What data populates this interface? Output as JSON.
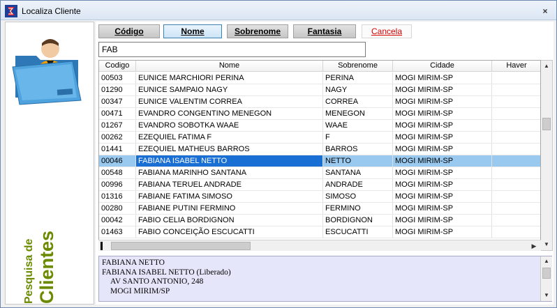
{
  "window": {
    "title": "Localiza Cliente",
    "close_glyph": "×"
  },
  "side_panel": {
    "line1": "Pesquisa de",
    "line2": "Clientes",
    "accent_color": "#6b8a00"
  },
  "buttons": {
    "codigo": "Código",
    "nome": "Nome",
    "sobrenome": "Sobrenome",
    "fantasia": "Fantasia",
    "cancela": "Cancela"
  },
  "search": {
    "value": "FAB"
  },
  "grid": {
    "columns": [
      "Codigo",
      "Nome",
      "Sobrenome",
      "Cidade",
      "Haver"
    ],
    "rows": [
      [
        "00503",
        "EUNICE MARCHIORI PERINA",
        "PERINA",
        "MOGI MIRIM-SP",
        ""
      ],
      [
        "01290",
        "EUNICE SAMPAIO NAGY",
        "NAGY",
        "MOGI MIRIM-SP",
        ""
      ],
      [
        "00347",
        "EUNICE VALENTIM CORREA",
        "CORREA",
        "MOGI MIRIM-SP",
        ""
      ],
      [
        "00471",
        "EVANDRO CONGENTINO MENEGON",
        "MENEGON",
        "MOGI MIRIM-SP",
        ""
      ],
      [
        "01267",
        "EVANDRO SOBOTKA WAAE",
        "WAAE",
        "MOGI MIRIM-SP",
        ""
      ],
      [
        "00262",
        "EZEQUIEL FATIMA F",
        "F",
        "MOGI MIRIM-SP",
        ""
      ],
      [
        "01441",
        "EZEQUIEL MATHEUS BARROS",
        "BARROS",
        "MOGI MIRIM-SP",
        ""
      ],
      [
        "00046",
        "FABIANA ISABEL NETTO",
        "NETTO",
        "MOGI MIRIM-SP",
        ""
      ],
      [
        "00548",
        "FABIANA MARINHO SANTANA",
        "SANTANA",
        "MOGI MIRIM-SP",
        ""
      ],
      [
        "00996",
        "FABIANA TERUEL ANDRADE",
        "ANDRADE",
        "MOGI MIRIM-SP",
        ""
      ],
      [
        "01316",
        "FABIANE FATIMA SIMOSO",
        "SIMOSO",
        "MOGI MIRIM-SP",
        ""
      ],
      [
        "00280",
        "FABIANE PUTINI FERMINO",
        "FERMINO",
        "MOGI MIRIM-SP",
        ""
      ],
      [
        "00042",
        "FABIO CELIA BORDIGNON",
        "BORDIGNON",
        "MOGI MIRIM-SP",
        ""
      ],
      [
        "01463",
        "FABIO CONCEIÇÃO ESCUCATTI",
        "ESCUCATTI",
        "MOGI MIRIM-SP",
        ""
      ]
    ],
    "selected_index": 7
  },
  "detail": {
    "line1": "FABIANA NETTO",
    "line2": "FABIANA ISABEL NETTO (Liberado)",
    "line3": "AV SANTO ANTONIO, 248",
    "line4": "MOGI MIRIM/SP"
  },
  "icons": {
    "app": "app-logo-icon",
    "avatar": "client-folder-icon",
    "scroll_up": "▲",
    "scroll_down": "▼",
    "scroll_left": "◀",
    "scroll_right": "▶"
  }
}
